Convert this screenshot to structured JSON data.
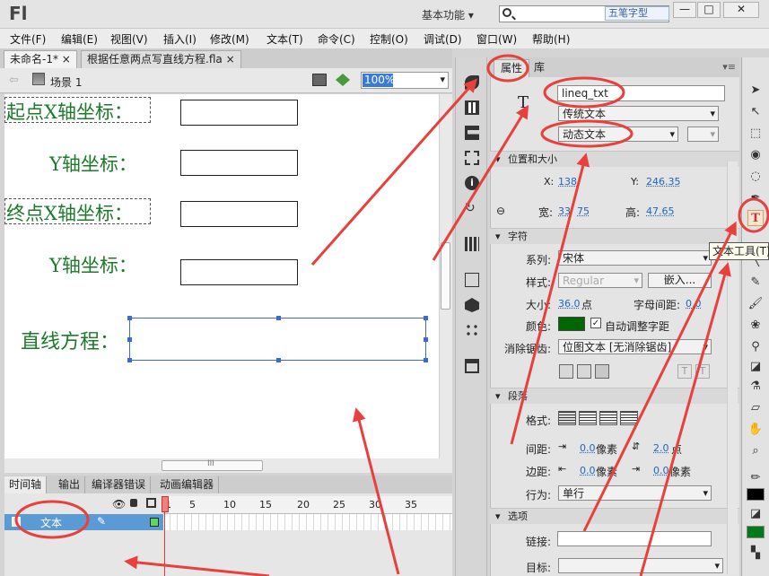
{
  "app": {
    "logo": "Fl",
    "workspace": "基本功能",
    "workspace_arrow": "▾",
    "ime": "五笔字型"
  },
  "window": {
    "minimize": "—",
    "maximize": "□",
    "close": "✕"
  },
  "menu": [
    "文件(F)",
    "编辑(E)",
    "视图(V)",
    "插入(I)",
    "修改(M)",
    "文本(T)",
    "命令(C)",
    "控制(O)",
    "调试(D)",
    "窗口(W)",
    "帮助(H)"
  ],
  "doc_tabs": [
    {
      "label": "未命名-1*",
      "close": "×"
    },
    {
      "label": "根据任意两点写直线方程.fla",
      "close": "×"
    }
  ],
  "scene": {
    "label": "场景 1",
    "zoom": "100%"
  },
  "stage": {
    "labels": [
      "起点X轴坐标：",
      "Y轴坐标：",
      "终点X轴坐标：",
      "Y轴坐标：",
      "直线方程："
    ]
  },
  "scroll": {
    "grip": "III"
  },
  "timeline": {
    "tabs": [
      "时间轴",
      "输出",
      "编译器错误",
      "动画编辑器"
    ],
    "layer_name": "文本",
    "frame_numbers": [
      "1",
      "5",
      "10",
      "15",
      "20",
      "25",
      "30",
      "35"
    ]
  },
  "properties": {
    "tabs": [
      "属性",
      "库"
    ],
    "instance_name": "lineq_txt",
    "text_engine": "传统文本",
    "text_type": "动态文本",
    "text_glyph": "T",
    "sections": {
      "position": "位置和大小",
      "character": "字符",
      "paragraph": "段落",
      "options": "选项"
    },
    "x_label": "X:",
    "x_value": "138.",
    "y_label": "Y:",
    "y_value": "246.35",
    "w_label": "宽:",
    "w_value": "33",
    "w_value_tail": "75",
    "h_label": "高:",
    "h_value": "47.65",
    "family_label": "系列:",
    "family_value": "宋体",
    "style_label": "样式:",
    "style_value": "Regular",
    "embed_button": "嵌入...",
    "size_label": "大小:",
    "size_value": "36.0",
    "size_unit": "点",
    "spacing_label": "字母间距:",
    "spacing_value": "0.0",
    "color_label": "颜色:",
    "auto_kern": "自动调整字距",
    "antialias_label": "消除锯齿:",
    "antialias_value": "位图文本 [无消除锯齿]",
    "format_label": "格式:",
    "indent_label": "间距:",
    "indent_value": "0.0",
    "indent_unit": "像素",
    "line_value": "2.0",
    "line_unit": "点",
    "margin_label": "边距:",
    "margin_left": "0.0",
    "margin_left_unit": "像素",
    "margin_right": "0.0",
    "margin_right_unit": "像素",
    "behavior_label": "行为:",
    "behavior_value": "单行",
    "link_label": "链接:",
    "target_label": "目标:"
  },
  "tooltip": "文本工具(T)",
  "colors": {
    "stage_text": "#1c7a2a",
    "annotation": "#e8403c",
    "selection": "#3a6bd5",
    "font_color": "#006600"
  }
}
